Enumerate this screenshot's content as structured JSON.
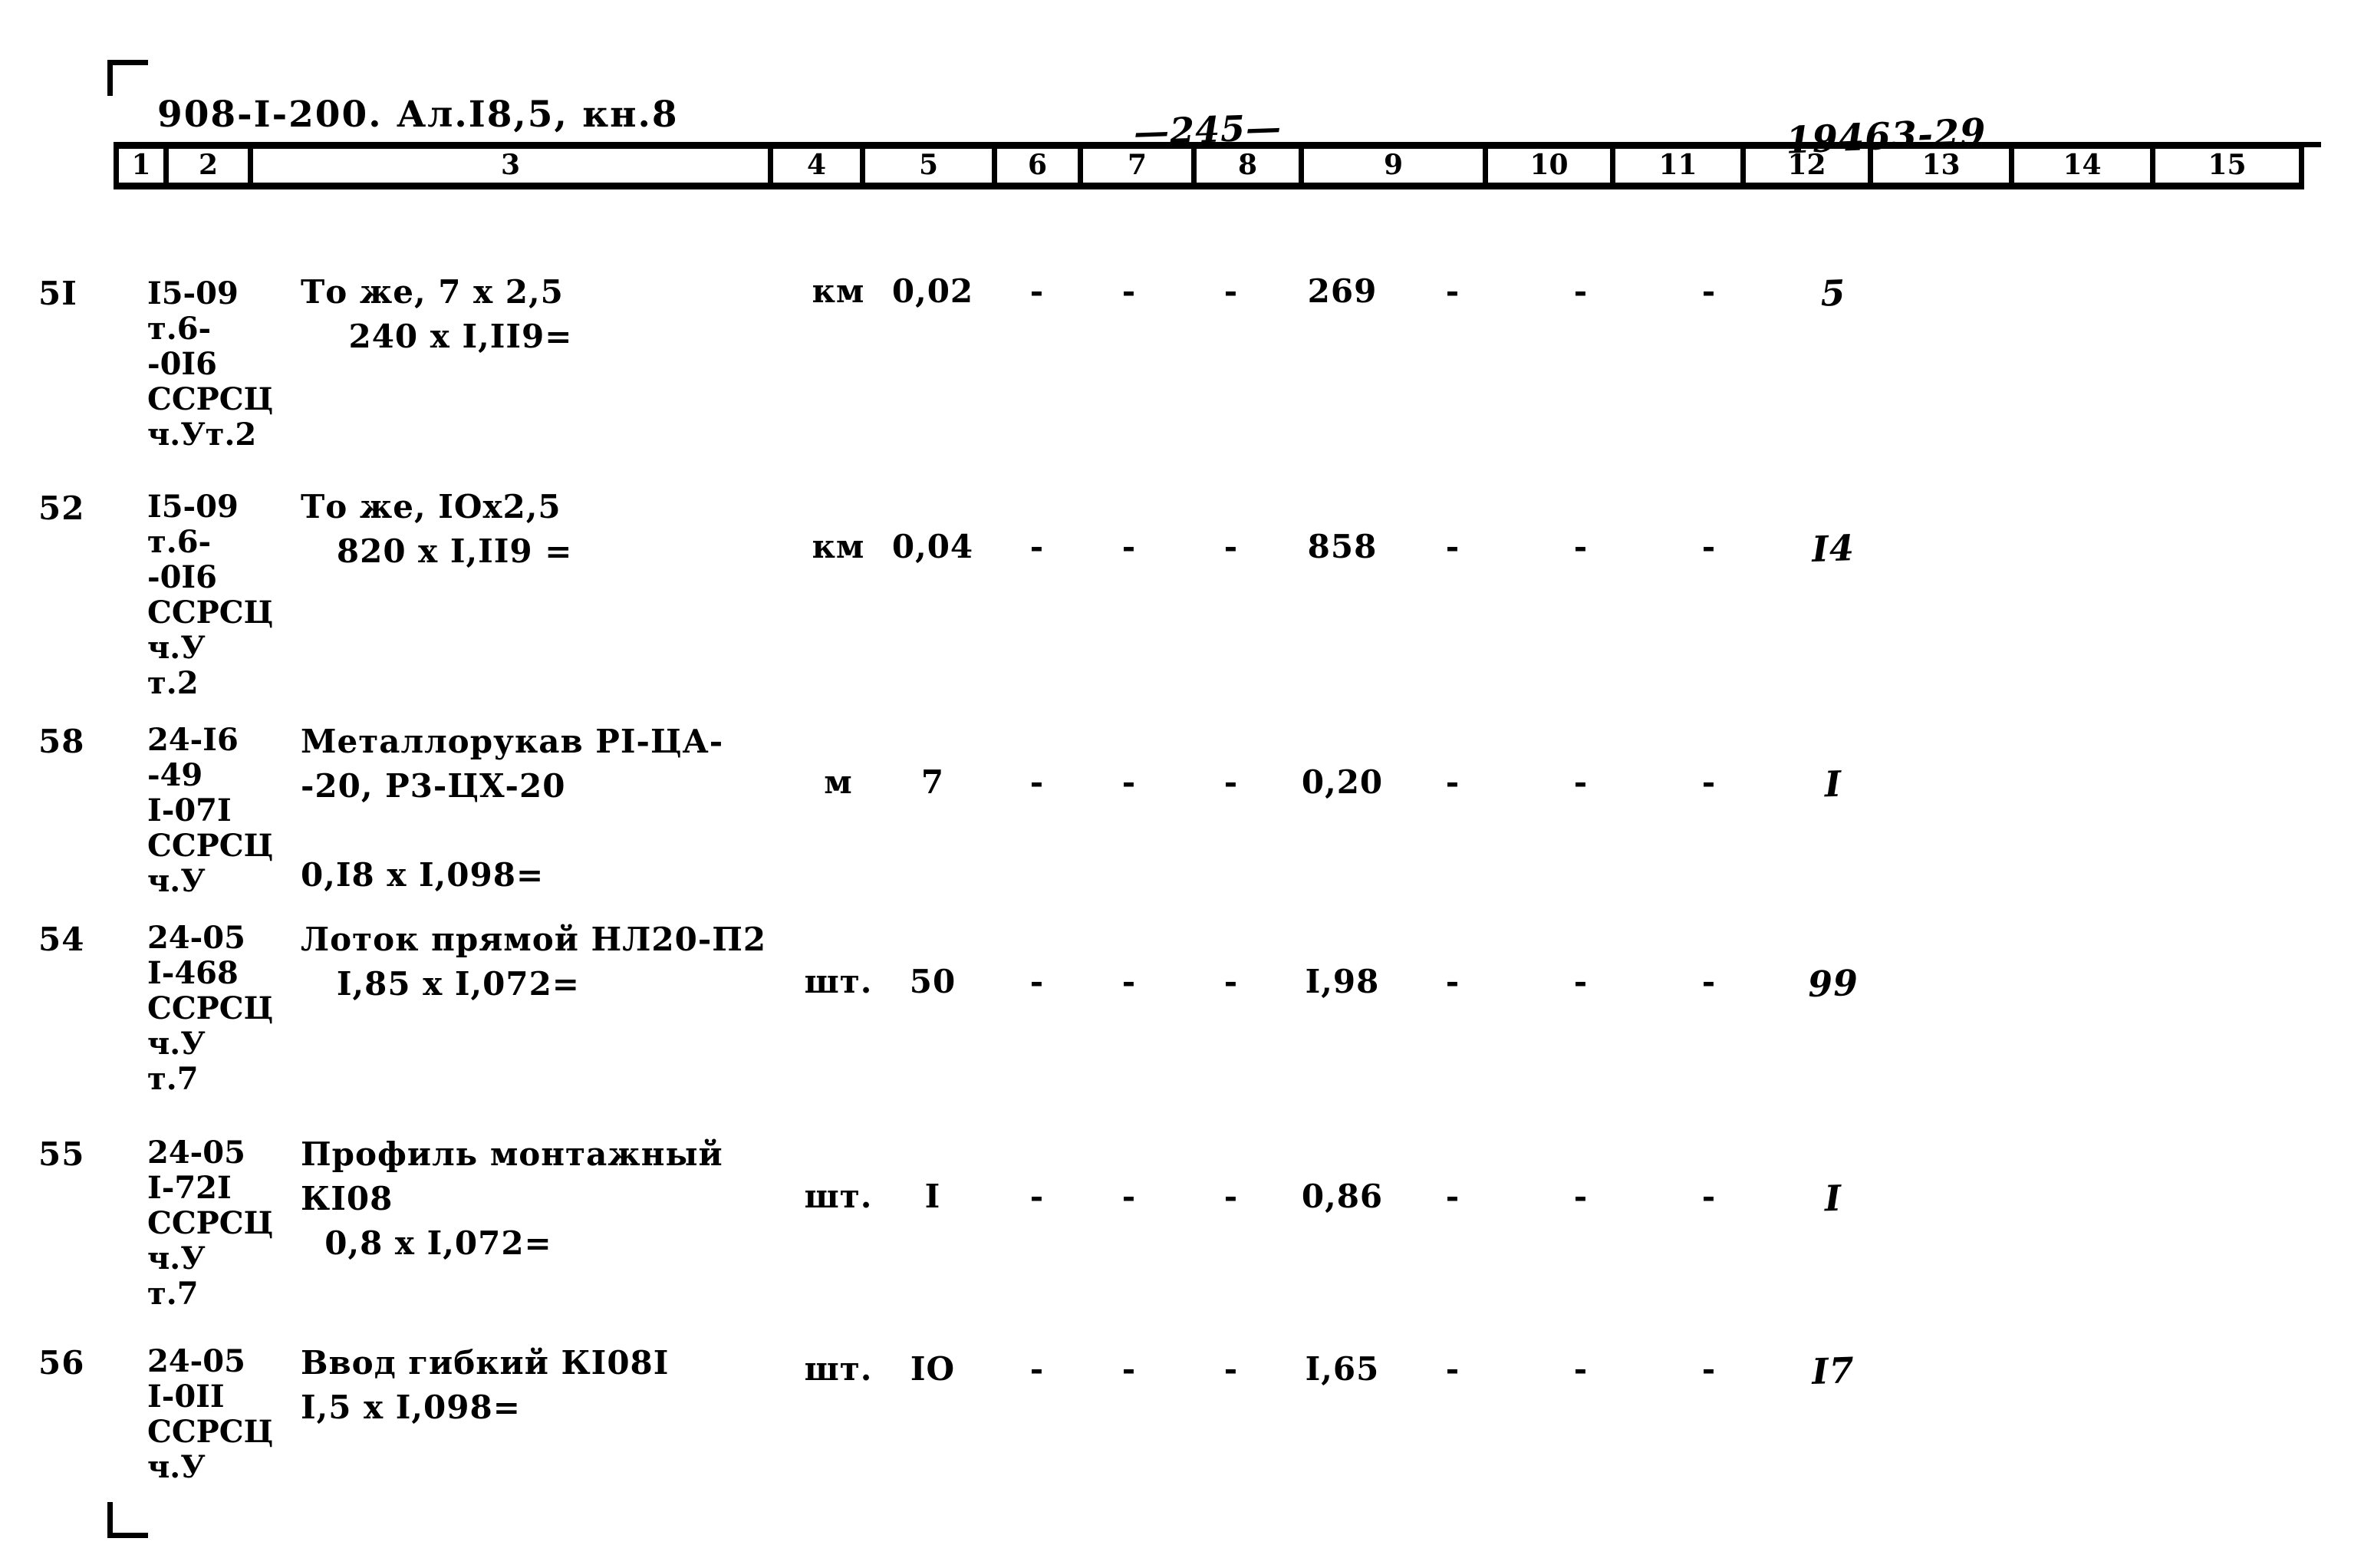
{
  "header": {
    "doc_code": "908-I-200. Ал.I8,5, кн.8",
    "page_number": "—245—",
    "sheet_number": "19463-29",
    "corner_mark_top": "corner-bracket-top-left",
    "corner_mark_bottom": "corner-bracket-bottom-left"
  },
  "table": {
    "column_headers": [
      "1",
      "2",
      "3",
      "4",
      "5",
      "6",
      "7",
      "8",
      "9",
      "10",
      "11",
      "12",
      "13",
      "14",
      "15"
    ],
    "rows": [
      {
        "num": "5I",
        "code": "I5-09\nт.6-\n-0I6\nССРСЦ\nч.Ут.2",
        "desc": "То же, 7 х 2,5\n    240 х I,II9=",
        "c4": "км",
        "c5": "0,02",
        "c6": "-",
        "c7": "-",
        "c8": "-",
        "c9": "269",
        "c10": "-",
        "c11": "-",
        "c12": "-",
        "c13": "5",
        "c14": "",
        "c15": ""
      },
      {
        "num": "52",
        "code": "I5-09\nт.6-\n-0I6\nССРСЦ\nч.У\nт.2",
        "desc": "То же, IOх2,5\n   820 х I,II9 =",
        "c4": "км",
        "c5": "0,04",
        "c6": "-",
        "c7": "-",
        "c8": "-",
        "c9": "858",
        "c10": "-",
        "c11": "-",
        "c12": "-",
        "c13": "I4",
        "c14": "",
        "c15": ""
      },
      {
        "num": "58",
        "code": "24-I6\n-49\nI-07I\nССРСЦ\nч.У",
        "desc": "Металлорукав РI-ЦА-\n-20, Р3-ЦХ-20\n\n0,I8 х I,098=",
        "c4": "м",
        "c5": "7",
        "c6": "-",
        "c7": "-",
        "c8": "-",
        "c9": "0,20",
        "c10": "-",
        "c11": "-",
        "c12": "-",
        "c13": "I",
        "c14": "",
        "c15": ""
      },
      {
        "num": "54",
        "code": "24-05\nI-468\nССРСЦ\nч.У\nт.7",
        "desc": "Лоток прямой НЛ20-П2\n   I,85 х I,072=",
        "c4": "шт.",
        "c5": "50",
        "c6": "-",
        "c7": "-",
        "c8": "-",
        "c9": "I,98",
        "c10": "-",
        "c11": "-",
        "c12": "-",
        "c13": "99",
        "c14": "",
        "c15": ""
      },
      {
        "num": "55",
        "code": "24-05\nI-72I\nССРСЦ\nч.У\nт.7",
        "desc": "Профиль монтажный\nКI08\n  0,8 х I,072=",
        "c4": "шт.",
        "c5": "I",
        "c6": "-",
        "c7": "-",
        "c8": "-",
        "c9": "0,86",
        "c10": "-",
        "c11": "-",
        "c12": "-",
        "c13": "I",
        "c14": "",
        "c15": ""
      },
      {
        "num": "56",
        "code": "24-05\nI-0II\nССРСЦ\nч.У",
        "desc": "Ввод гибкий КI08I\nI,5 х I,098=",
        "c4": "шт.",
        "c5": "IO",
        "c6": "-",
        "c7": "-",
        "c8": "-",
        "c9": "I,65",
        "c10": "-",
        "c11": "-",
        "c12": "-",
        "c13": "I7",
        "c14": "",
        "c15": ""
      }
    ]
  }
}
